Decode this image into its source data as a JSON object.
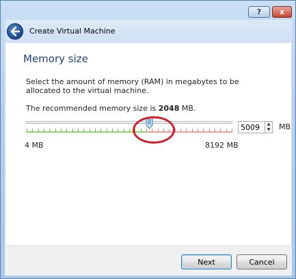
{
  "window": {
    "help_label": "?",
    "close_label": "x"
  },
  "header": {
    "title": "Create Virtual Machine"
  },
  "page": {
    "title": "Memory size",
    "description": "Select the amount of memory (RAM) in megabytes to be allocated to the virtual machine.",
    "recommended_prefix": "The recommended memory size is ",
    "recommended_value": "2048",
    "recommended_suffix": " MB."
  },
  "memory_slider": {
    "min_label": "4 MB",
    "max_label": "8192 MB",
    "min": 4,
    "max": 8192,
    "recommended": 2048,
    "value": 5009,
    "unit": "MB",
    "safe_color": "#8fd36a",
    "warning_color": "#f0a0a0",
    "highlight_color": "#d11d2a"
  },
  "buttons": {
    "next": "Next",
    "cancel": "Cancel"
  }
}
